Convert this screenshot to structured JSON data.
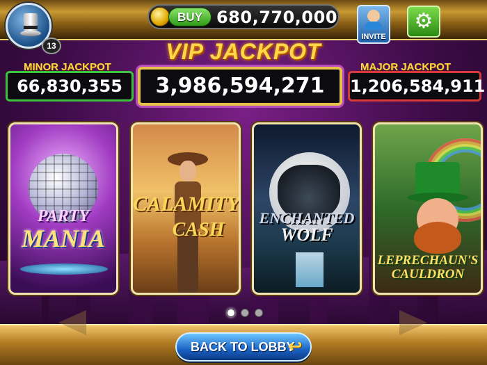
{
  "header": {
    "level": "13",
    "buy_label": "BUY",
    "coin_balance": "680,770,000",
    "invite_label": "INVITE",
    "icons": {
      "avatar": "top-hat-icon",
      "coin": "coin-icon",
      "invite": "person-icon",
      "settings": "gear-icon"
    }
  },
  "jackpots": {
    "vip_title": "VIP JACKPOT",
    "minor_label": "MINOR JACKPOT",
    "minor_value": "66,830,355",
    "vip_value": "3,986,594,271",
    "major_label": "MAJOR JACKPOT",
    "major_value": "1,206,584,911",
    "colors": {
      "minor_border": "#3cc23c",
      "major_border": "#d83a3a",
      "vip_border": "#e6c24b"
    }
  },
  "games": [
    {
      "title_line1": "PARTY",
      "title_line2": "MANIA"
    },
    {
      "title_line1": "CALAMITY",
      "title_line2": "CASH"
    },
    {
      "title_line1": "ENCHANTED",
      "title_line2": "WOLF"
    },
    {
      "title_line1": "LEPRECHAUN'S",
      "title_line2": "CAULDRON"
    }
  ],
  "pager": {
    "pages": 3,
    "active_index": 0
  },
  "footer": {
    "back_label": "BACK TO LOBBY",
    "back_icon": "return-arrow-icon"
  }
}
